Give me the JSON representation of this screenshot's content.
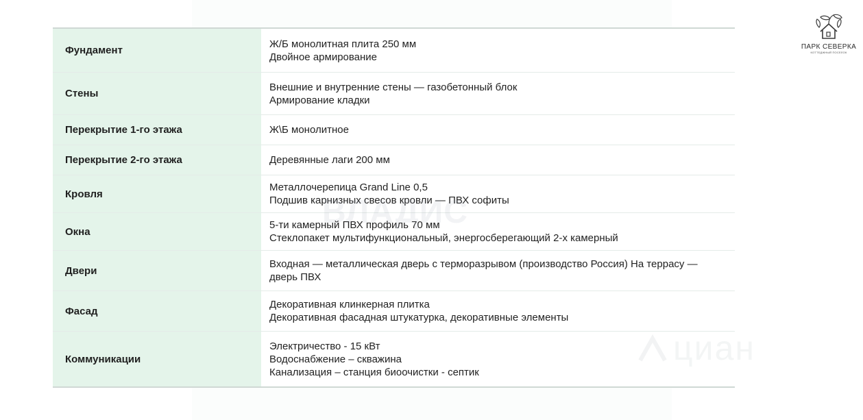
{
  "rows": [
    {
      "label": "Фундамент",
      "lines": [
        "Ж/Б монолитная плита 250 мм",
        "Двойное армирование"
      ]
    },
    {
      "label": "Стены",
      "lines": [
        "Внешние и внутренние стены — газобетонный блок",
        "Армирование кладки"
      ]
    },
    {
      "label": "Перекрытие 1-го этажа",
      "lines": [
        "Ж\\Б монолитное"
      ]
    },
    {
      "label": "Перекрытие 2-го этажа",
      "lines": [
        "Деревянные лаги 200 мм"
      ]
    },
    {
      "label": "Кровля",
      "lines": [
        "Металлочерепица Grand Line 0,5",
        "Подшив карнизных свесов кровли — ПВХ софиты"
      ]
    },
    {
      "label": "Окна",
      "lines": [
        "5-ти камерный ПВХ профиль 70 мм",
        "Стеклопакет мультифункциональный, энергосберегающий 2-х камерный"
      ]
    },
    {
      "label": "Двери",
      "lines": [
        "Входная — металлическая дверь с терморазрывом (производство Россия) На террасу —",
        "дверь ПВХ"
      ]
    },
    {
      "label": "Фасад",
      "lines": [
        "Декоративная клинкерная плитка",
        "Декоративная фасадная штукатурка, декоративные элементы"
      ]
    },
    {
      "label": "Коммуникации",
      "lines": [
        "Электричество - 15 кВт",
        "Водоснабжение – скважина",
        "Канализация – станция биоочистки - септик"
      ]
    }
  ],
  "logo": {
    "title": "ПАРК СЕВЕРКА",
    "subtitle": "КОТТЕДЖНЫЙ ПОСЕЛОК",
    "icon": "house-leaves-icon"
  },
  "watermarks": {
    "first": "ВЛАДИС",
    "second": "циан"
  },
  "colors": {
    "label_bg": "#e4f4ea",
    "border": "#cfd8d4"
  }
}
